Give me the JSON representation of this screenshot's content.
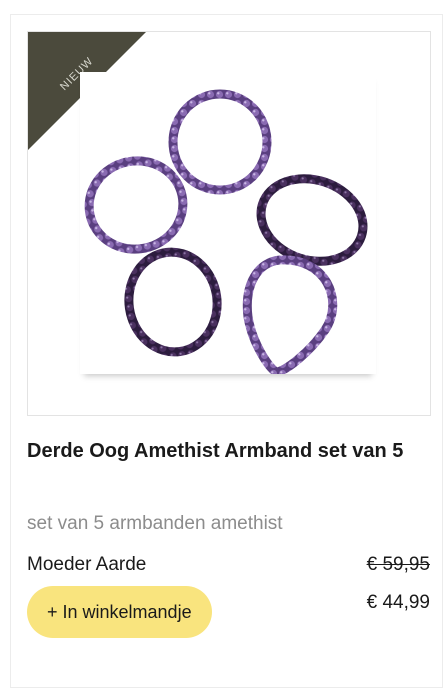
{
  "product": {
    "badge": "NIEUW",
    "title": "Derde Oog Amethist Armband set van 5",
    "subtitle": "set van 5 armbanden amethist",
    "brand": "Moeder Aarde",
    "price_old": "€ 59,95",
    "price_new": "€ 44,99",
    "add_to_cart_label": "+ In winkelmandje",
    "image_alt": "Vijf amethist kralenarmbanden",
    "colors": {
      "badge_bg": "#4b4a3c",
      "button_bg": "#f9e47e",
      "bead_light": "#8a6bb2",
      "bead_dark": "#3a2550"
    }
  }
}
